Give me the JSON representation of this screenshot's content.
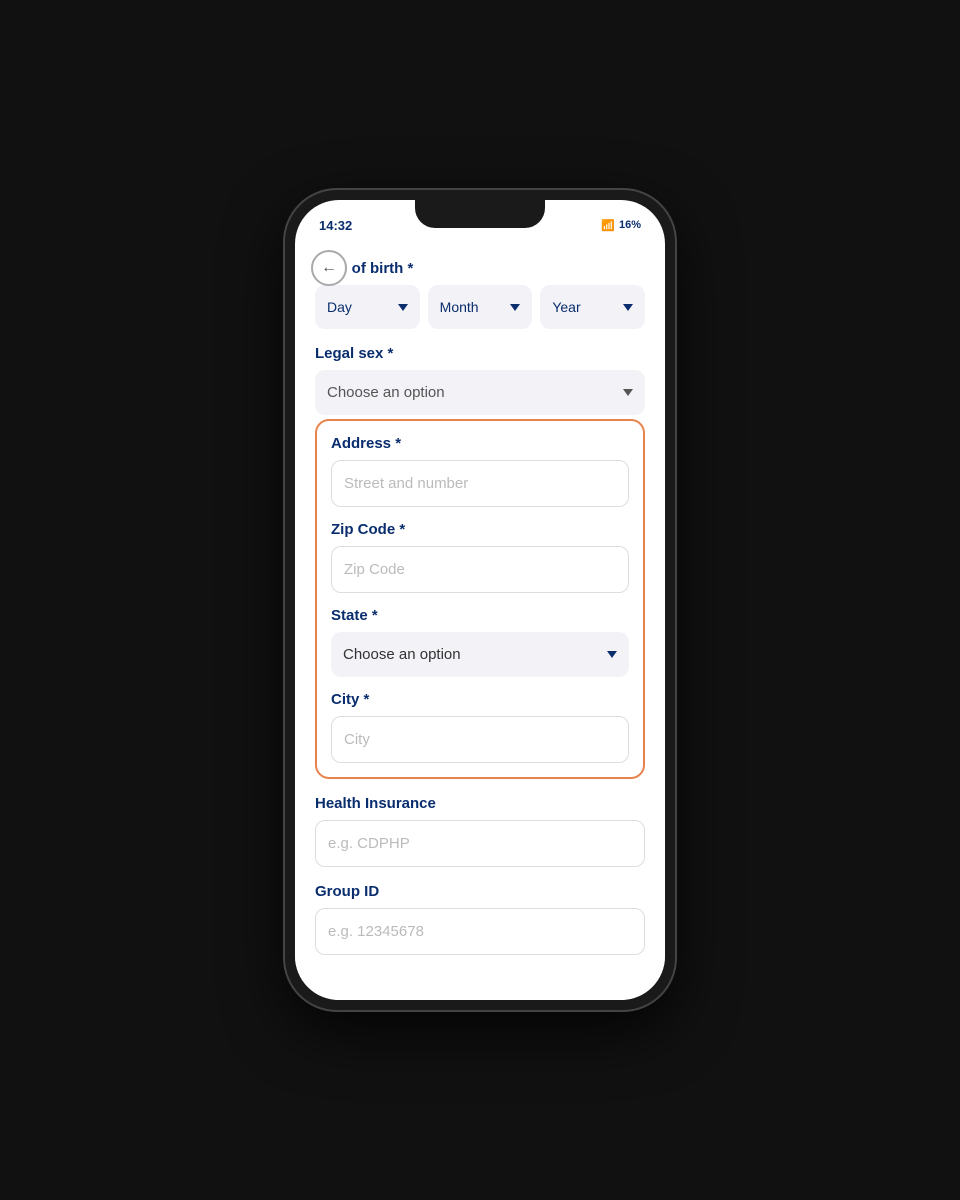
{
  "statusBar": {
    "time": "14:32",
    "battery": "16%",
    "icons": "LTE"
  },
  "form": {
    "dateOfBirth": {
      "label": "Date of birth *",
      "dayLabel": "Day",
      "monthLabel": "Month",
      "yearLabel": "Year"
    },
    "legalSex": {
      "label": "Legal sex *",
      "placeholder": "Choose an option"
    },
    "address": {
      "label": "Address *",
      "placeholder": "Street and number"
    },
    "zipCode": {
      "label": "Zip Code *",
      "placeholder": "Zip Code"
    },
    "state": {
      "label": "State *",
      "placeholder": "Choose an option"
    },
    "city": {
      "label": "City *",
      "placeholder": "City"
    },
    "healthInsurance": {
      "label": "Health Insurance",
      "placeholder": "e.g. CDPHP"
    },
    "groupId": {
      "label": "Group ID",
      "placeholder": "e.g. 12345678"
    }
  }
}
